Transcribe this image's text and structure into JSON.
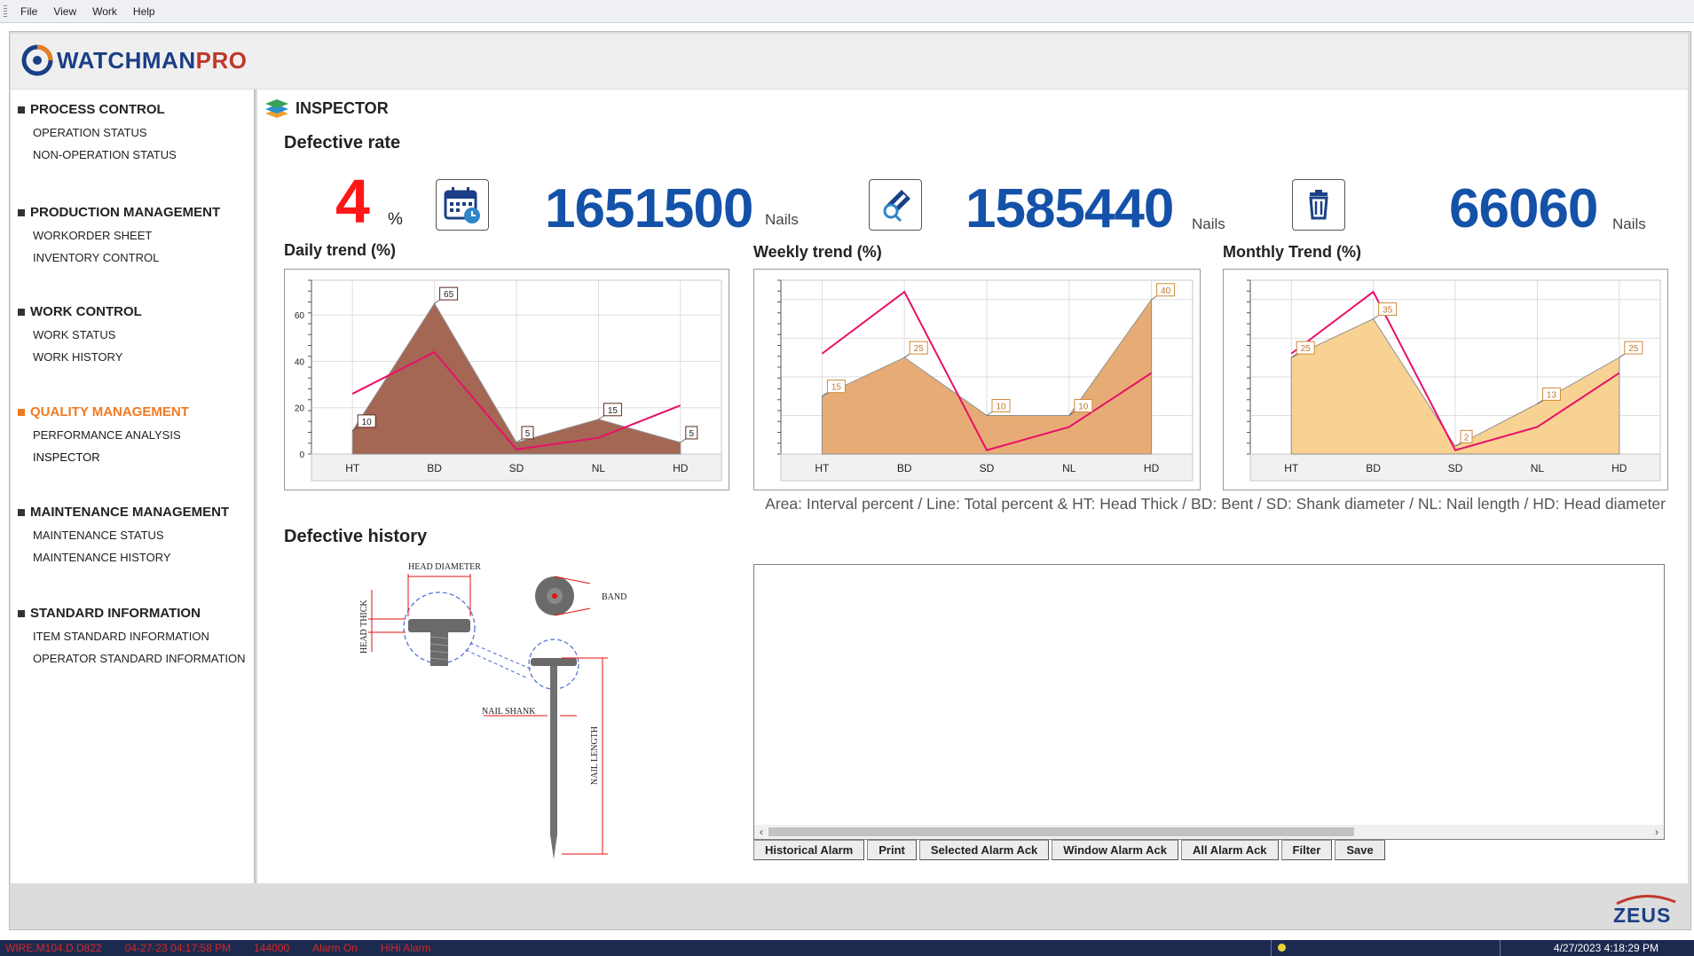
{
  "menu": {
    "items": [
      "File",
      "View",
      "Work",
      "Help"
    ]
  },
  "logo": {
    "name_a": "WATCHMAN",
    "name_b": "PRO"
  },
  "sidebar": {
    "sections": [
      {
        "title": "PROCESS CONTROL",
        "items": [
          "OPERATION STATUS",
          "NON-OPERATION STATUS"
        ]
      },
      {
        "title": "PRODUCTION MANAGEMENT",
        "items": [
          "WORKORDER SHEET",
          "INVENTORY CONTROL"
        ]
      },
      {
        "title": "WORK CONTROL",
        "items": [
          "WORK STATUS",
          "WORK HISTORY"
        ]
      },
      {
        "title": "QUALITY MANAGEMENT",
        "items": [
          "PERFORMANCE ANALYSIS",
          "INSPECTOR"
        ],
        "active": true
      },
      {
        "title": "MAINTENANCE MANAGEMENT",
        "items": [
          "MAINTENANCE STATUS",
          "MAINTENANCE HISTORY"
        ]
      },
      {
        "title": "STANDARD INFORMATION",
        "items": [
          "ITEM STANDARD INFORMATION",
          "OPERATOR STANDARD INFORMATION"
        ]
      }
    ]
  },
  "page": {
    "title": "INSPECTOR"
  },
  "defective_rate": {
    "heading": "Defective rate",
    "percent_value": "4",
    "percent_sign": "%",
    "total_value": "1651500",
    "total_unit": "Nails",
    "good_value": "1585440",
    "good_unit": "Nails",
    "defect_value": "66060",
    "defect_unit": "Nails"
  },
  "charts": {
    "categories": [
      "HT",
      "BD",
      "SD",
      "NL",
      "HD"
    ],
    "legend_text": "Area: Interval percent  /  Line: Total percent  &  HT: Head Thick  /  BD: Bent  /  SD: Shank diameter  /  NL: Nail length  /  HD: Head diameter",
    "daily": {
      "title": "Daily trend (%)",
      "yticks": [
        "0",
        "20",
        "40",
        "60"
      ]
    },
    "weekly": {
      "title": "Weekly trend (%)"
    },
    "monthly": {
      "title": "Monthly Trend (%)"
    }
  },
  "chart_data": [
    {
      "type": "area",
      "title": "Daily trend (%)",
      "categories": [
        "HT",
        "BD",
        "SD",
        "NL",
        "HD"
      ],
      "ylim": [
        0,
        75
      ],
      "series": [
        {
          "values": [
            10,
            65,
            5,
            15,
            5
          ],
          "labels": [
            "10",
            "65",
            "5",
            "15",
            "5"
          ]
        },
        {
          "values": [
            26,
            44,
            2,
            7,
            21
          ]
        }
      ],
      "area_color": "#9c5b45",
      "line_color": "#e8106a"
    },
    {
      "type": "area",
      "title": "Weekly trend (%)",
      "categories": [
        "HT",
        "BD",
        "SD",
        "NL",
        "HD"
      ],
      "ylim": [
        0,
        45
      ],
      "series": [
        {
          "values": [
            15,
            25,
            10,
            10,
            40
          ],
          "labels": [
            "15",
            "25",
            "10",
            "10",
            "40"
          ]
        },
        {
          "values": [
            26,
            42,
            1,
            7,
            21
          ]
        }
      ],
      "area_color": "#e5a56a",
      "line_color": "#e8106a"
    },
    {
      "type": "area",
      "title": "Monthly Trend (%)",
      "categories": [
        "HT",
        "BD",
        "SD",
        "NL",
        "HD"
      ],
      "ylim": [
        0,
        45
      ],
      "series": [
        {
          "values": [
            25,
            35,
            2,
            13,
            25
          ],
          "labels": [
            "25",
            "35",
            "2",
            "13",
            "25"
          ]
        },
        {
          "values": [
            26,
            42,
            1,
            7,
            21
          ]
        }
      ],
      "area_color": "#f8cf8a",
      "line_color": "#e8106a"
    }
  ],
  "history": {
    "heading": "Defective history",
    "diagram_labels": {
      "head_diameter": "HEAD DIAMETER",
      "head_thick": "HEAD THICK",
      "band": "BAND",
      "nail_shank": "NAIL SHANK",
      "nail_length": "NAIL LENGTH"
    },
    "buttons": [
      "Historical Alarm",
      "Print",
      "Selected Alarm Ack",
      "Window Alarm Ack",
      "All Alarm Ack",
      "Filter",
      "Save"
    ]
  },
  "brand": {
    "footer_logo": "ZEUS"
  },
  "statusbar": {
    "tag": "WIRE.M104.D.D822",
    "time": "04-27-23 04:17:58 PM",
    "value": "144000",
    "state": "Alarm On",
    "level": "HiHi Alarm",
    "clock": "4/27/2023 4:18:29 PM"
  }
}
